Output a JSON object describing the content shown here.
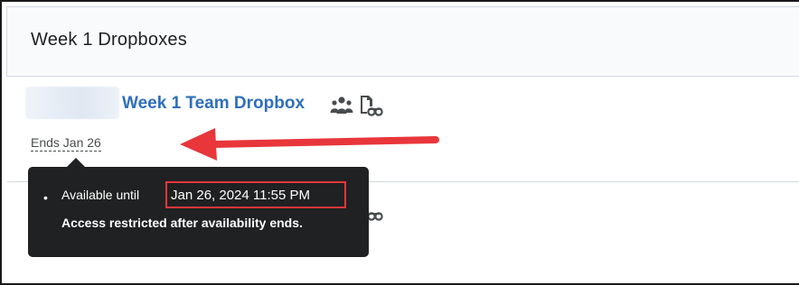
{
  "section": {
    "title": "Week 1 Dropboxes"
  },
  "dropbox": {
    "name": "Week 1 Team Dropbox",
    "group_icon": "group-icon",
    "submission_icon": "folder-submission-icon",
    "ends_label": "Ends Jan 26"
  },
  "tooltip": {
    "bullet": "•",
    "available_prefix": "Available until",
    "available_date": "Jan 26, 2024 11:55 PM",
    "restriction_note": "Access restricted after availability ends."
  },
  "colors": {
    "link": "#2e6fbd",
    "annotation_red": "#e8363b",
    "tooltip_bg": "#202122"
  }
}
